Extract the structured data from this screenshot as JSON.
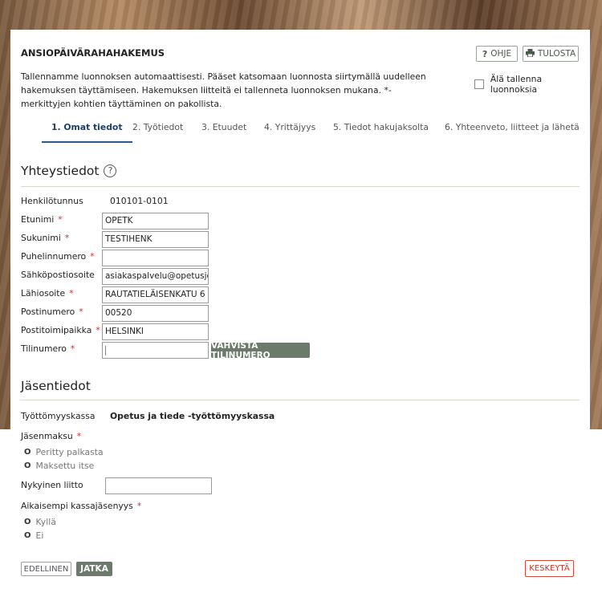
{
  "header": {
    "title": "ANSIOPÄIVÄRAHAHAKEMUS",
    "help_label": "OHJE",
    "print_label": "TULOSTA",
    "help_icon_glyph": "?",
    "print_icon": "printer-icon"
  },
  "intro": {
    "text": "Tallennamme luonnoksen automaattisesti. Pääset katsomaan luonnosta siirtymällä uudelleen hakemuksen täyttämiseen. Hakemuksen liitteitä ei tallenneta luonnoksen mukana. *-merkittyjen kohtien täyttäminen on pakollista.",
    "no_save_label": "Älä tallenna luonnoksia"
  },
  "tabs": [
    {
      "label": "1. Omat tiedot",
      "active": true
    },
    {
      "label": "2. Työtiedot"
    },
    {
      "label": "3. Etuudet"
    },
    {
      "label": "4. Yrittäjyys"
    },
    {
      "label": "5. Tiedot hakujaksolta"
    },
    {
      "label": "6. Yhteenveto, liitteet ja lähetä"
    }
  ],
  "contact": {
    "heading": "Yhteystiedot",
    "ssn_label": "Henkilötunnus",
    "ssn_value": "010101-0101",
    "first_name_label": "Etunimi",
    "first_name_value": "OPETK",
    "last_name_label": "Sukunimi",
    "last_name_value": "TESTIHENK",
    "phone_label": "Puhelinnumero",
    "phone_value": "",
    "email_label": "Sähköpostiosoite",
    "email_value": "asiakaspalvelu@opetusjo",
    "address_label": "Lähiosoite",
    "address_value": "RAUTATIELÄISENKATU 6",
    "postal_code_label": "Postinumero",
    "postal_code_value": "00520",
    "city_label": "Postitoimipaikka",
    "city_value": "HELSINKI",
    "account_label": "Tilinumero",
    "account_value": "",
    "verify_account_label": "VAHVISTA TILINUMERO",
    "required_mark": "*"
  },
  "membership": {
    "heading": "Jäsentiedot",
    "fund_label": "Työttömyyskassa",
    "fund_value": "Opetus ja tiede -työttömyyskassa",
    "fee_label": "Jäsenmaksu",
    "fee_options": [
      "Peritty palkasta",
      "Maksettu itse"
    ],
    "current_union_label": "Nykyinen liitto",
    "current_union_value": "",
    "previous_label": "Aikaisempi kassajäsenyys",
    "previous_options": [
      "Kyllä",
      "Ei"
    ],
    "radio_glyph": "O"
  },
  "footer": {
    "prev_label": "EDELLINEN",
    "next_label": "JATKA",
    "cancel_label": "KESKEYTÄ"
  },
  "colors": {
    "accent_green": "#6b7a6a",
    "tab_active": "#1e3f66",
    "required": "#d0302f",
    "cancel": "#c0392b"
  }
}
